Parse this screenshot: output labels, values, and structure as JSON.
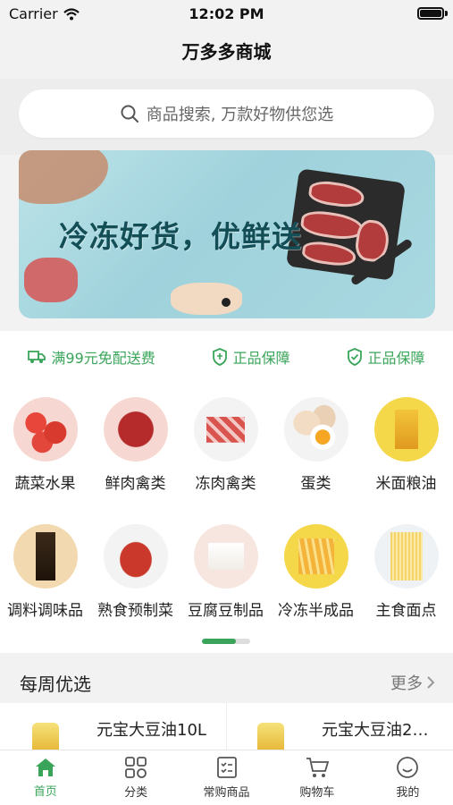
{
  "status_bar": {
    "carrier": "Carrier",
    "time": "12:02 PM"
  },
  "nav": {
    "title": "万多多商城"
  },
  "search": {
    "placeholder": "商品搜索, 万款好物供您选"
  },
  "banner": {
    "text": "冷冻好货，优鲜送"
  },
  "services": [
    {
      "icon": "truck-icon",
      "label": "满99元免配送费"
    },
    {
      "icon": "shield-icon",
      "label": "正品保障"
    },
    {
      "icon": "shield-check-icon",
      "label": "正品保障"
    }
  ],
  "categories": [
    {
      "label": "蔬菜水果",
      "color": "#f7d7d2"
    },
    {
      "label": "鲜肉禽类",
      "color": "#f7d7d2"
    },
    {
      "label": "冻肉禽类",
      "color": "#f3f3f3"
    },
    {
      "label": "蛋类",
      "color": "#f3f3f3"
    },
    {
      "label": "米面粮油",
      "color": "#f5d84a"
    },
    {
      "label": "调料调味品",
      "color": "#f3d9b0"
    },
    {
      "label": "熟食预制菜",
      "color": "#f3f3f3"
    },
    {
      "label": "豆腐豆制品",
      "color": "#f7e6df"
    },
    {
      "label": "冷冻半成品",
      "color": "#f5d84a"
    },
    {
      "label": "主食面点",
      "color": "#eef2f5"
    }
  ],
  "pager": {
    "active_fraction": 0.7
  },
  "weekly": {
    "title": "每周优选",
    "more": "更多"
  },
  "products": [
    {
      "name": "元宝大豆油10L"
    },
    {
      "name": "元宝大豆油2…"
    }
  ],
  "tabbar": [
    {
      "icon": "home-icon",
      "label": "首页",
      "active": true
    },
    {
      "icon": "category-icon",
      "label": "分类",
      "active": false
    },
    {
      "icon": "list-icon",
      "label": "常购商品",
      "active": false
    },
    {
      "icon": "cart-icon",
      "label": "购物车",
      "active": false
    },
    {
      "icon": "smile-icon",
      "label": "我的",
      "active": false
    }
  ],
  "colors": {
    "accent": "#3aa55a",
    "background": "#f2f2f2"
  }
}
